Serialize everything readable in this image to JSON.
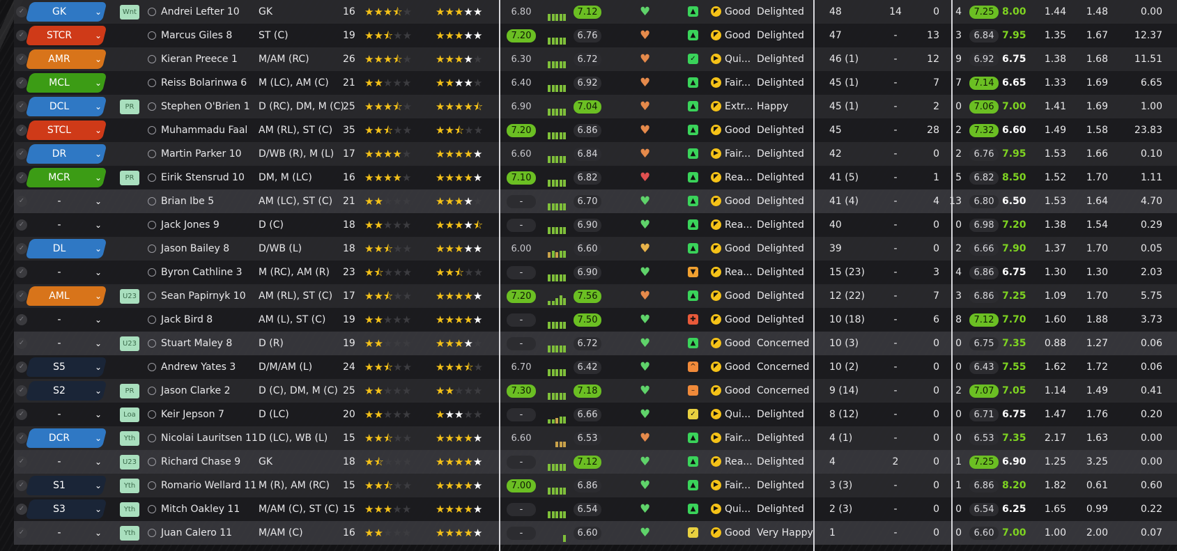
{
  "colors": {
    "gk": "#2f78c4",
    "def": "#2f78c4",
    "mid": "#3c9c15",
    "att": "#d8741a",
    "st": "#cf3a18",
    "sub": "#1a2537",
    "green_pill": "#6bbf23",
    "star": "#f5c218"
  },
  "icons": {
    "check": "check-circle-icon",
    "chevron": "chevron-down-icon",
    "avatar": "person-icon",
    "heart": "heart-icon",
    "fitness": "thumbs-up-icon",
    "form": "arrow-icon"
  },
  "rows": [
    {
      "pos": "GK",
      "posc": "#2f78c4",
      "tag": "Wnt",
      "name": "Andrei Lefter 10",
      "position": "GK",
      "age": "16",
      "ca": 3.5,
      "pa": 5,
      "pot_from": 4,
      "av": "6.80",
      "avg": "",
      "av2": "7.12",
      "av2g": true,
      "bars": [
        5,
        5,
        5,
        5,
        5
      ],
      "heart": "#5fd36a",
      "sq": "#3ad35a",
      "sqg": "▲",
      "circ": "◤",
      "form": "Good",
      "morale": "Delighted",
      "apps": "48",
      "gls": "14",
      "ast": "0",
      "mom": "4",
      "r1": "7.25",
      "r1g": true,
      "r2": "8.00",
      "r2c": "#7ed321",
      "x1": "1.44",
      "x2": "1.48",
      "x3": "0.00"
    },
    {
      "pos": "STCR",
      "posc": "#cf3a18",
      "tag": "",
      "name": "Marcus Giles 8",
      "position": "ST (C)",
      "age": "19",
      "ca": 2.5,
      "pa": 5,
      "pot_from": 4,
      "av": "7.20",
      "avg": "g",
      "av2": "6.76",
      "av2g": false,
      "bars": [
        5,
        5,
        5,
        5,
        5
      ],
      "heart": "#e58a4b",
      "sq": "#3ad35a",
      "sqg": "▲",
      "circ": "◤",
      "form": "Good",
      "morale": "Delighted",
      "apps": "47",
      "gls": "-",
      "ast": "13",
      "mom": "3",
      "r1": "6.84",
      "r1g": false,
      "r2": "7.95",
      "r2c": "#7ed321",
      "x1": "1.35",
      "x2": "1.67",
      "x3": "12.37"
    },
    {
      "pos": "AMR",
      "posc": "#d8741a",
      "tag": "",
      "name": "Kieran Preece 1",
      "position": "M/AM (RC)",
      "age": "26",
      "ca": 3.5,
      "pa": 4,
      "pot_from": 4,
      "av": "6.30",
      "avg": "",
      "av2": "6.72",
      "av2g": false,
      "bars": [
        5,
        5,
        5,
        5,
        5
      ],
      "heart": "#e58a4b",
      "sq": "#3ad35a",
      "sqg": "✓",
      "circ": "▶",
      "form": "Qui...",
      "morale": "Delighted",
      "apps": "46 (1)",
      "gls": "-",
      "ast": "12",
      "mom": "9",
      "r1": "6.92",
      "r1g": false,
      "r2": "6.75",
      "r2c": "#ffffff",
      "x1": "1.38",
      "x2": "1.68",
      "x3": "11.51"
    },
    {
      "pos": "MCL",
      "posc": "#3c9c15",
      "tag": "",
      "name": "Reiss Bolarinwa 6",
      "position": "M (LC), AM (C)",
      "age": "21",
      "ca": 2,
      "pa": 4,
      "pot_from": 3,
      "av": "6.40",
      "avg": "",
      "av2": "6.92",
      "av2g": false,
      "bars": [
        5,
        5,
        5,
        5,
        5
      ],
      "heart": "#e58a4b",
      "sq": "#3ad35a",
      "sqg": "▲",
      "circ": "▶",
      "form": "Fair...",
      "morale": "Delighted",
      "apps": "45 (1)",
      "gls": "-",
      "ast": "7",
      "mom": "7",
      "r1": "7.14",
      "r1g": true,
      "r2": "6.65",
      "r2c": "#ffffff",
      "x1": "1.33",
      "x2": "1.69",
      "x3": "6.65"
    },
    {
      "pos": "DCL",
      "posc": "#2f78c4",
      "tag": "PR",
      "name": "Stephen O'Brien 1",
      "position": "D (RC), DM, M (C)",
      "age": "25",
      "ca": 3.5,
      "pa": 4.5,
      "pot_from": 5,
      "av": "6.90",
      "avg": "",
      "av2": "7.04",
      "av2g": true,
      "bars": [
        5,
        5,
        5,
        5,
        5
      ],
      "heart": "#e58a4b",
      "sq": "#3ad35a",
      "sqg": "▲",
      "circ": "◤",
      "form": "Extr...",
      "morale": "Happy",
      "apps": "45 (1)",
      "gls": "-",
      "ast": "2",
      "mom": "0",
      "r1": "7.06",
      "r1g": true,
      "r2": "7.00",
      "r2c": "#7ed321",
      "x1": "1.41",
      "x2": "1.69",
      "x3": "1.00"
    },
    {
      "pos": "STCL",
      "posc": "#cf3a18",
      "tag": "",
      "name": "Muhammadu Faal",
      "position": "AM (RL), ST (C)",
      "age": "35",
      "ca": 2.5,
      "pa": 2.5,
      "pot_from": 5,
      "av": "7.20",
      "avg": "g",
      "av2": "6.86",
      "av2g": false,
      "bars": [
        5,
        5,
        5,
        5,
        5
      ],
      "heart": "#e58a4b",
      "sq": "#3ad35a",
      "sqg": "▲",
      "circ": "◤",
      "form": "Good",
      "morale": "Delighted",
      "apps": "45",
      "gls": "-",
      "ast": "28",
      "mom": "2",
      "r1": "7.32",
      "r1g": true,
      "r2": "6.60",
      "r2c": "#ffffff",
      "x1": "1.49",
      "x2": "1.58",
      "x3": "23.83"
    },
    {
      "pos": "DR",
      "posc": "#2f78c4",
      "tag": "",
      "name": "Martin Parker 10",
      "position": "D/WB (R), M (L)",
      "age": "17",
      "ca": 4,
      "pa": 5,
      "pot_from": 5,
      "av": "6.60",
      "avg": "",
      "av2": "6.84",
      "av2g": false,
      "bars": [
        5,
        5,
        5,
        5,
        5
      ],
      "heart": "#e58a4b",
      "sq": "#3ad35a",
      "sqg": "▲",
      "circ": "▶",
      "form": "Fair...",
      "morale": "Delighted",
      "apps": "42",
      "gls": "-",
      "ast": "0",
      "mom": "2",
      "r1": "6.76",
      "r1g": false,
      "r2": "7.95",
      "r2c": "#7ed321",
      "x1": "1.53",
      "x2": "1.66",
      "x3": "0.10"
    },
    {
      "pos": "MCR",
      "posc": "#3c9c15",
      "tag": "PR",
      "name": "Eirik Stensrud 10",
      "position": "DM, M (LC)",
      "age": "16",
      "ca": 4,
      "pa": 5,
      "pot_from": 5,
      "av": "7.10",
      "avg": "g",
      "av2": "6.82",
      "av2g": false,
      "bars": [
        5,
        5,
        5,
        5,
        5
      ],
      "heart": "#e05050",
      "sq": "#3ad35a",
      "sqg": "▲",
      "circ": "◤",
      "form": "Rea...",
      "morale": "Delighted",
      "apps": "41 (5)",
      "gls": "-",
      "ast": "1",
      "mom": "5",
      "r1": "6.82",
      "r1g": false,
      "r2": "8.50",
      "r2c": "#7ed321",
      "x1": "1.52",
      "x2": "1.70",
      "x3": "1.11"
    },
    {
      "pos": "-",
      "posc": "",
      "tag": "",
      "name": "Brian Ibe 5",
      "position": "AM (LC), ST (C)",
      "age": "21",
      "ca": 2,
      "pa": 4,
      "pot_from": 4,
      "av": "-",
      "avg": "d",
      "av2": "6.70",
      "av2g": false,
      "bars": [
        5,
        5,
        5,
        5,
        5
      ],
      "heart": "#5fd36a",
      "sq": "#3ad35a",
      "sqg": "▲",
      "circ": "◤",
      "form": "Good",
      "morale": "Delighted",
      "apps": "41 (4)",
      "gls": "-",
      "ast": "4",
      "mom": "13",
      "r1": "6.80",
      "r1g": false,
      "r2": "6.50",
      "r2c": "#ffffff",
      "x1": "1.53",
      "x2": "1.64",
      "x3": "4.70",
      "sel": true
    },
    {
      "pos": "-",
      "posc": "",
      "tag": "",
      "name": "Jack Jones 9",
      "position": "D (C)",
      "age": "18",
      "ca": 2,
      "pa": 4.5,
      "pot_from": 4,
      "av": "-",
      "avg": "d",
      "av2": "6.90",
      "av2g": false,
      "bars": [
        5,
        5,
        5,
        5,
        5
      ],
      "heart": "#5fd36a",
      "sq": "#3ad35a",
      "sqg": "▲",
      "circ": "◤",
      "form": "Rea...",
      "morale": "Delighted",
      "apps": "40",
      "gls": "-",
      "ast": "0",
      "mom": "0",
      "r1": "6.98",
      "r1g": false,
      "r2": "7.20",
      "r2c": "#7ed321",
      "x1": "1.38",
      "x2": "1.54",
      "x3": "0.29"
    },
    {
      "pos": "DL",
      "posc": "#2f78c4",
      "tag": "",
      "name": "Jason Bailey 8",
      "position": "D/WB (L)",
      "age": "18",
      "ca": 2.5,
      "pa": 5,
      "pot_from": 4,
      "av": "6.00",
      "avg": "",
      "av2": "6.60",
      "av2g": false,
      "bars": [
        4,
        5,
        4,
        5,
        5
      ],
      "heart": "#e8b34a",
      "sq": "#3ad35a",
      "sqg": "▲",
      "circ": "◤",
      "form": "Good",
      "morale": "Delighted",
      "apps": "39",
      "gls": "-",
      "ast": "0",
      "mom": "2",
      "r1": "6.66",
      "r1g": false,
      "r2": "7.90",
      "r2c": "#7ed321",
      "x1": "1.37",
      "x2": "1.70",
      "x3": "0.05"
    },
    {
      "pos": "-",
      "posc": "",
      "tag": "",
      "name": "Byron Cathline 3",
      "position": "M (RC), AM (R)",
      "age": "23",
      "ca": 1.5,
      "pa": 2.5,
      "pot_from": 5,
      "av": "-",
      "avg": "d",
      "av2": "6.90",
      "av2g": false,
      "bars": [
        5,
        5,
        5,
        5,
        5
      ],
      "heart": "#5fd36a",
      "sq": "#f0a030",
      "sqg": "▼",
      "circ": "◤",
      "form": "Rea...",
      "morale": "Delighted",
      "apps": "15 (23)",
      "gls": "-",
      "ast": "3",
      "mom": "4",
      "r1": "6.86",
      "r1g": false,
      "r2": "6.75",
      "r2c": "#ffffff",
      "x1": "1.30",
      "x2": "1.30",
      "x3": "2.03"
    },
    {
      "pos": "AML",
      "posc": "#d8741a",
      "tag": "U23",
      "name": "Sean Papirnyk 10",
      "position": "AM (RL), ST (C)",
      "age": "17",
      "ca": 2.5,
      "pa": 5,
      "pot_from": 5,
      "av": "7.20",
      "avg": "g",
      "av2": "7.56",
      "av2g": true,
      "bars": [
        3,
        3,
        5,
        7,
        5
      ],
      "heart": "#e58a4b",
      "sq": "#3ad35a",
      "sqg": "▲",
      "circ": "◤",
      "form": "Good",
      "morale": "Delighted",
      "apps": "12 (22)",
      "gls": "-",
      "ast": "7",
      "mom": "3",
      "r1": "6.86",
      "r1g": false,
      "r2": "7.25",
      "r2c": "#7ed321",
      "x1": "1.09",
      "x2": "1.70",
      "x3": "5.75"
    },
    {
      "pos": "-",
      "posc": "",
      "tag": "",
      "name": "Jack Bird 8",
      "position": "AM (L), ST (C)",
      "age": "19",
      "ca": 2,
      "pa": 5,
      "pot_from": 5,
      "av": "-",
      "avg": "d",
      "av2": "7.50",
      "av2g": true,
      "bars": [
        5,
        5,
        5,
        5,
        5
      ],
      "heart": "#5fd36a",
      "sq": "#e85a3a",
      "sqg": "✚",
      "circ": "◤",
      "form": "Good",
      "morale": "Delighted",
      "apps": "10 (18)",
      "gls": "-",
      "ast": "6",
      "mom": "8",
      "r1": "7.12",
      "r1g": true,
      "r2": "7.70",
      "r2c": "#7ed321",
      "x1": "1.60",
      "x2": "1.88",
      "x3": "3.73"
    },
    {
      "pos": "-",
      "posc": "",
      "tag": "U23",
      "name": "Stuart Maley 8",
      "position": "D (R)",
      "age": "19",
      "ca": 2,
      "pa": 4,
      "pot_from": 4,
      "av": "-",
      "avg": "d",
      "av2": "6.72",
      "av2g": false,
      "bars": [
        5,
        5,
        5,
        5,
        5
      ],
      "heart": "#5fd36a",
      "sq": "#3ad35a",
      "sqg": "▲",
      "circ": "◤",
      "form": "Good",
      "morale": "Concerned",
      "apps": "10 (3)",
      "gls": "-",
      "ast": "0",
      "mom": "0",
      "r1": "6.75",
      "r1g": false,
      "r2": "7.35",
      "r2c": "#7ed321",
      "x1": "0.88",
      "x2": "1.27",
      "x3": "0.06",
      "sel": true
    },
    {
      "pos": "S5",
      "posc": "#1a2537",
      "tag": "",
      "name": "Andrew Yates 3",
      "position": "D/M/AM (L)",
      "age": "24",
      "ca": 2.5,
      "pa": 3.5,
      "pot_from": 5,
      "av": "6.70",
      "avg": "",
      "av2": "6.42",
      "av2g": false,
      "bars": [
        5,
        5,
        5,
        5,
        5
      ],
      "heart": "#5fd36a",
      "sq": "#f08a3a",
      "sqg": "^",
      "circ": "◤",
      "form": "Good",
      "morale": "Concerned",
      "apps": "10 (2)",
      "gls": "-",
      "ast": "0",
      "mom": "0",
      "r1": "6.43",
      "r1g": false,
      "r2": "7.55",
      "r2c": "#7ed321",
      "x1": "1.62",
      "x2": "1.72",
      "x3": "0.06"
    },
    {
      "pos": "S2",
      "posc": "#1a2537",
      "tag": "PR",
      "name": "Jason Clarke 2",
      "position": "D (C), DM, M (C)",
      "age": "25",
      "ca": 2,
      "pa": 2,
      "pot_from": 5,
      "av": "7.30",
      "avg": "g",
      "av2": "7.18",
      "av2g": true,
      "bars": [
        5,
        5,
        5,
        5,
        5
      ],
      "heart": "#5fd36a",
      "sq": "#f08a3a",
      "sqg": "–",
      "circ": "◤",
      "form": "Good",
      "morale": "Concerned",
      "apps": "9 (14)",
      "gls": "-",
      "ast": "0",
      "mom": "2",
      "r1": "7.07",
      "r1g": true,
      "r2": "7.05",
      "r2c": "#7ed321",
      "x1": "1.14",
      "x2": "1.49",
      "x3": "0.41"
    },
    {
      "pos": "-",
      "posc": "",
      "tag": "Loa",
      "name": "Keir Jepson 7",
      "position": "D (LC)",
      "age": "20",
      "ca": 2,
      "pa": 3,
      "pot_from": 2,
      "av": "-",
      "avg": "d",
      "av2": "6.66",
      "av2g": false,
      "bars": [
        3,
        3,
        4,
        5,
        5
      ],
      "heart": "#5fd36a",
      "sq": "#e8d040",
      "sqg": "✓",
      "circ": "▶",
      "form": "Qui...",
      "morale": "Delighted",
      "apps": "8 (12)",
      "gls": "-",
      "ast": "0",
      "mom": "0",
      "r1": "6.71",
      "r1g": false,
      "r2": "6.75",
      "r2c": "#ffffff",
      "x1": "1.47",
      "x2": "1.76",
      "x3": "0.20"
    },
    {
      "pos": "DCR",
      "posc": "#2f78c4",
      "tag": "Yth",
      "name": "Nicolai Lauritsen 11",
      "position": "D (LC), WB (L)",
      "age": "15",
      "ca": 2.5,
      "pa": 5,
      "pot_from": 5,
      "av": "6.60",
      "avg": "",
      "av2": "6.53",
      "av2g": false,
      "bars": [
        0,
        0,
        4,
        4,
        4
      ],
      "heart": "#e58a4b",
      "sq": "#3ad35a",
      "sqg": "▲",
      "circ": "▶",
      "form": "Fair...",
      "morale": "Delighted",
      "apps": "4 (1)",
      "gls": "-",
      "ast": "0",
      "mom": "0",
      "r1": "6.53",
      "r1g": false,
      "r2": "7.35",
      "r2c": "#7ed321",
      "x1": "2.17",
      "x2": "1.63",
      "x3": "0.00"
    },
    {
      "pos": "-",
      "posc": "",
      "tag": "U23",
      "name": "Richard Chase 9",
      "position": "GK",
      "age": "18",
      "ca": 1.5,
      "pa": 5,
      "pot_from": 5,
      "av": "-",
      "avg": "d",
      "av2": "7.12",
      "av2g": true,
      "bars": [
        5,
        5,
        5,
        5,
        5
      ],
      "heart": "#5fd36a",
      "sq": "#3ad35a",
      "sqg": "▲",
      "circ": "◤",
      "form": "Rea...",
      "morale": "Delighted",
      "apps": "4",
      "gls": "2",
      "ast": "0",
      "mom": "1",
      "r1": "7.25",
      "r1g": true,
      "r2": "6.90",
      "r2c": "#ffffff",
      "x1": "1.25",
      "x2": "3.25",
      "x3": "0.00",
      "sel": true
    },
    {
      "pos": "S1",
      "posc": "#1a2537",
      "tag": "Yth",
      "name": "Romario Wellard 11",
      "position": "M (R), AM (RC)",
      "age": "15",
      "ca": 2.5,
      "pa": 5,
      "pot_from": 5,
      "av": "7.00",
      "avg": "g",
      "av2": "6.86",
      "av2g": false,
      "bars": [
        5,
        5,
        5,
        5,
        5
      ],
      "heart": "#5fd36a",
      "sq": "#3ad35a",
      "sqg": "▲",
      "circ": "▶",
      "form": "Fair...",
      "morale": "Delighted",
      "apps": "3 (3)",
      "gls": "-",
      "ast": "0",
      "mom": "1",
      "r1": "6.86",
      "r1g": false,
      "r2": "8.20",
      "r2c": "#7ed321",
      "x1": "1.82",
      "x2": "0.61",
      "x3": "0.60"
    },
    {
      "pos": "S3",
      "posc": "#1a2537",
      "tag": "Yth",
      "name": "Mitch Oakley 11",
      "position": "M/AM (C), ST (C)",
      "age": "15",
      "ca": 3,
      "pa": 5,
      "pot_from": 5,
      "av": "-",
      "avg": "d",
      "av2": "6.54",
      "av2g": false,
      "bars": [
        5,
        5,
        5,
        5,
        5
      ],
      "heart": "#5fd36a",
      "sq": "#3ad35a",
      "sqg": "▲",
      "circ": "▶",
      "form": "Qui...",
      "morale": "Delighted",
      "apps": "2 (3)",
      "gls": "-",
      "ast": "0",
      "mom": "0",
      "r1": "6.54",
      "r1g": false,
      "r2": "6.25",
      "r2c": "#ffffff",
      "x1": "1.65",
      "x2": "0.99",
      "x3": "0.22"
    },
    {
      "pos": "-",
      "posc": "",
      "tag": "Yth",
      "name": "Juan Calero 11",
      "position": "M/AM (C)",
      "age": "16",
      "ca": 2,
      "pa": 5,
      "pot_from": 5,
      "av": "-",
      "avg": "d",
      "av2": "6.60",
      "av2g": false,
      "bars": [
        0,
        0,
        0,
        0,
        5
      ],
      "heart": "#5fd36a",
      "sq": "#e8d040",
      "sqg": "✓",
      "circ": "◤",
      "form": "Good",
      "morale": "Very Happy",
      "apps": "1",
      "gls": "-",
      "ast": "0",
      "mom": "0",
      "r1": "6.60",
      "r1g": false,
      "r2": "7.00",
      "r2c": "#7ed321",
      "x1": "1.00",
      "x2": "2.00",
      "x3": "0.07",
      "sel": true
    }
  ]
}
